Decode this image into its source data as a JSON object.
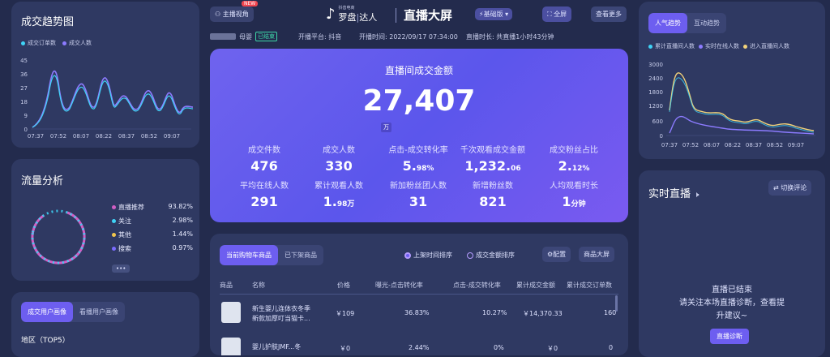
{
  "header": {
    "left_button": "主播视角",
    "new_badge": "NEW",
    "logo_top": "抖音电商",
    "logo_main": "罗盘",
    "logo_sub": "达人",
    "title": "直播大屏",
    "version": "基础版",
    "fullscreen": "全屏",
    "more": "查看更多",
    "anchor_suffix": "母婴",
    "status": "已结束",
    "platform": "开播平台: 抖音",
    "start_time": "开播时间: 2022/09/17 07:34:00",
    "duration": "直播时长: 共直播1小时43分钟"
  },
  "trend": {
    "title": "成交趋势图",
    "legend": [
      "成交订单数",
      "成交人数"
    ],
    "yticks": [
      "45",
      "36",
      "27",
      "18",
      "9",
      "0"
    ],
    "xticks": [
      "07:37",
      "07:52",
      "08:07",
      "08:22",
      "08:37",
      "08:52",
      "09:07"
    ]
  },
  "traffic": {
    "title": "流量分析",
    "items": [
      {
        "label": "直播推荐",
        "value": "93.82%",
        "color": "#d15fc4"
      },
      {
        "label": "关注",
        "value": "2.98%",
        "color": "#3fd3f6"
      },
      {
        "label": "其他",
        "value": "1.44%",
        "color": "#f2c64d"
      },
      {
        "label": "搜索",
        "value": "0.97%",
        "color": "#7b6cff"
      }
    ],
    "more": "•••"
  },
  "portrait": {
    "tabs": [
      "成交用户画像",
      "看播用户画像"
    ],
    "region": "地区（TOP5）"
  },
  "main": {
    "title": "直播间成交金额",
    "amount": "27,407",
    "unit": "万",
    "metrics": [
      {
        "label": "成交件数",
        "value": "476",
        "suffix": ""
      },
      {
        "label": "成交人数",
        "value": "330",
        "suffix": ""
      },
      {
        "label": "点击-成交转化率",
        "value": "5.",
        "suffix": "98%"
      },
      {
        "label": "千次观看成交金额",
        "value": "1,232.",
        "suffix": "06"
      },
      {
        "label": "成交粉丝占比",
        "value": "2.",
        "suffix": "12%"
      },
      {
        "label": "平均在线人数",
        "value": "291",
        "suffix": ""
      },
      {
        "label": "累计观看人数",
        "value": "1.",
        "suffix": "98万"
      },
      {
        "label": "新加粉丝团人数",
        "value": "31",
        "suffix": ""
      },
      {
        "label": "新增粉丝数",
        "value": "821",
        "suffix": ""
      },
      {
        "label": "人均观看时长",
        "value": "1",
        "suffix": "分钟"
      }
    ]
  },
  "products": {
    "tabs": [
      "当前购物车商品",
      "已下架商品"
    ],
    "sort": [
      "上架时间排序",
      "成交金额排序"
    ],
    "config": "配置",
    "screen": "商品大屏",
    "columns": [
      "商品",
      "名称",
      "价格",
      "曝光-点击转化率",
      "点击-成交转化率",
      "累计成交金额",
      "累计成交订单数"
    ],
    "rows": [
      {
        "name": "新生婴儿连体衣冬季",
        "name2": "新款加厚叮当猫卡...",
        "price": "￥109",
        "ctr": "36.83%",
        "cvr": "10.27%",
        "amount": "￥14,370.33",
        "orders": "160"
      },
      {
        "name": "婴儿护肤JMF...冬",
        "name2": "",
        "price": "￥0",
        "ctr": "2.44%",
        "cvr": "0%",
        "amount": "￥0",
        "orders": "0"
      }
    ]
  },
  "popularity": {
    "tabs": [
      "人气趋势",
      "互动趋势"
    ],
    "legend": [
      "累计直播间人数",
      "实时在线人数",
      "进入直播间人数"
    ],
    "yticks": [
      "3000",
      "2400",
      "1800",
      "1200",
      "600",
      "0"
    ],
    "xticks": [
      "07:37",
      "07:52",
      "08:07",
      "08:22",
      "08:37",
      "08:52",
      "09:07"
    ]
  },
  "live": {
    "title": "实时直播",
    "switch": "切换评论",
    "ended": "直播已结束",
    "hint1": "请关注本场直播诊断，查看提",
    "hint2": "升建议~",
    "diagnose": "直播诊断"
  },
  "colors": {
    "accent": "#6d5ef0",
    "cyan": "#3fd3f6",
    "purple": "#8c7bff",
    "yellow": "#f2d27a"
  }
}
